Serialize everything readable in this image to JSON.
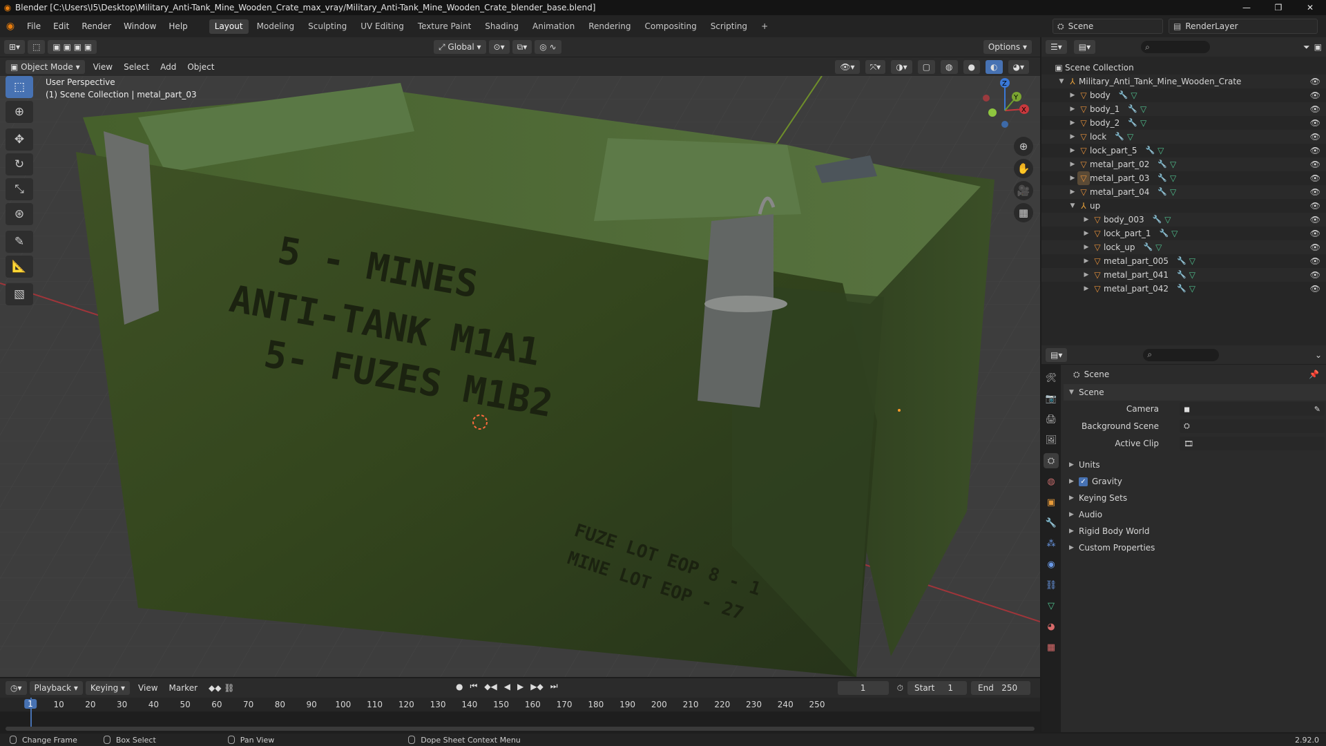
{
  "titlebar": {
    "title": "Blender [C:\\Users\\I5\\Desktop\\Military_Anti-Tank_Mine_Wooden_Crate_max_vray/Military_Anti-Tank_Mine_Wooden_Crate_blender_base.blend]"
  },
  "menu": [
    "File",
    "Edit",
    "Render",
    "Window",
    "Help"
  ],
  "workspaces": [
    "Layout",
    "Modeling",
    "Sculpting",
    "UV Editing",
    "Texture Paint",
    "Shading",
    "Animation",
    "Rendering",
    "Compositing",
    "Scripting"
  ],
  "scene_name": "Scene",
  "render_layer": "RenderLayer",
  "viewport": {
    "orientation": "Global",
    "options_label": "Options",
    "mode": "Object Mode",
    "menus": [
      "View",
      "Select",
      "Add",
      "Object"
    ],
    "perspective_label": "User Perspective",
    "collection_label": "(1) Scene Collection | metal_part_03",
    "crate_text": {
      "line1": "5 - MINES",
      "line2": "ANTI-TANK M1A1",
      "line3": "5- FUZES M1B2",
      "line4": "FUZE LOT EOP 8 - 1",
      "line5": "MINE LOT EOP - 27"
    },
    "gizmo": {
      "x": "X",
      "y": "Y",
      "z": "Z"
    }
  },
  "outliner": {
    "root": "Scene Collection",
    "items": [
      {
        "label": "Military_Anti_Tank_Mine_Wooden_Crate"
      },
      {
        "label": "body"
      },
      {
        "label": "body_1"
      },
      {
        "label": "body_2"
      },
      {
        "label": "lock"
      },
      {
        "label": "lock_part_5"
      },
      {
        "label": "metal_part_02"
      },
      {
        "label": "metal_part_03"
      },
      {
        "label": "metal_part_04"
      },
      {
        "label": "up"
      },
      {
        "label": "body_003"
      },
      {
        "label": "lock_part_1"
      },
      {
        "label": "lock_up"
      },
      {
        "label": "metal_part_005"
      },
      {
        "label": "metal_part_041"
      },
      {
        "label": "metal_part_042"
      }
    ]
  },
  "properties": {
    "context": "Scene",
    "panel": "Scene",
    "camera_label": "Camera",
    "background_label": "Background Scene",
    "clip_label": "Active Clip",
    "sections": [
      "Units",
      "Gravity",
      "Keying Sets",
      "Audio",
      "Rigid Body World",
      "Custom Properties"
    ]
  },
  "timeline": {
    "menus": [
      "Playback",
      "Keying",
      "View",
      "Marker"
    ],
    "current_frame": "1",
    "start_label": "Start",
    "start": "1",
    "end_label": "End",
    "end": "250",
    "ticks": [
      "10",
      "20",
      "30",
      "40",
      "50",
      "60",
      "70",
      "80",
      "90",
      "100",
      "110",
      "120",
      "130",
      "140",
      "150",
      "160",
      "170",
      "180",
      "190",
      "200",
      "210",
      "220",
      "230",
      "240",
      "250"
    ]
  },
  "statusbar": {
    "items": [
      "Change Frame",
      "Box Select",
      "Pan View",
      "Dope Sheet Context Menu"
    ],
    "version": "2.92.0"
  }
}
